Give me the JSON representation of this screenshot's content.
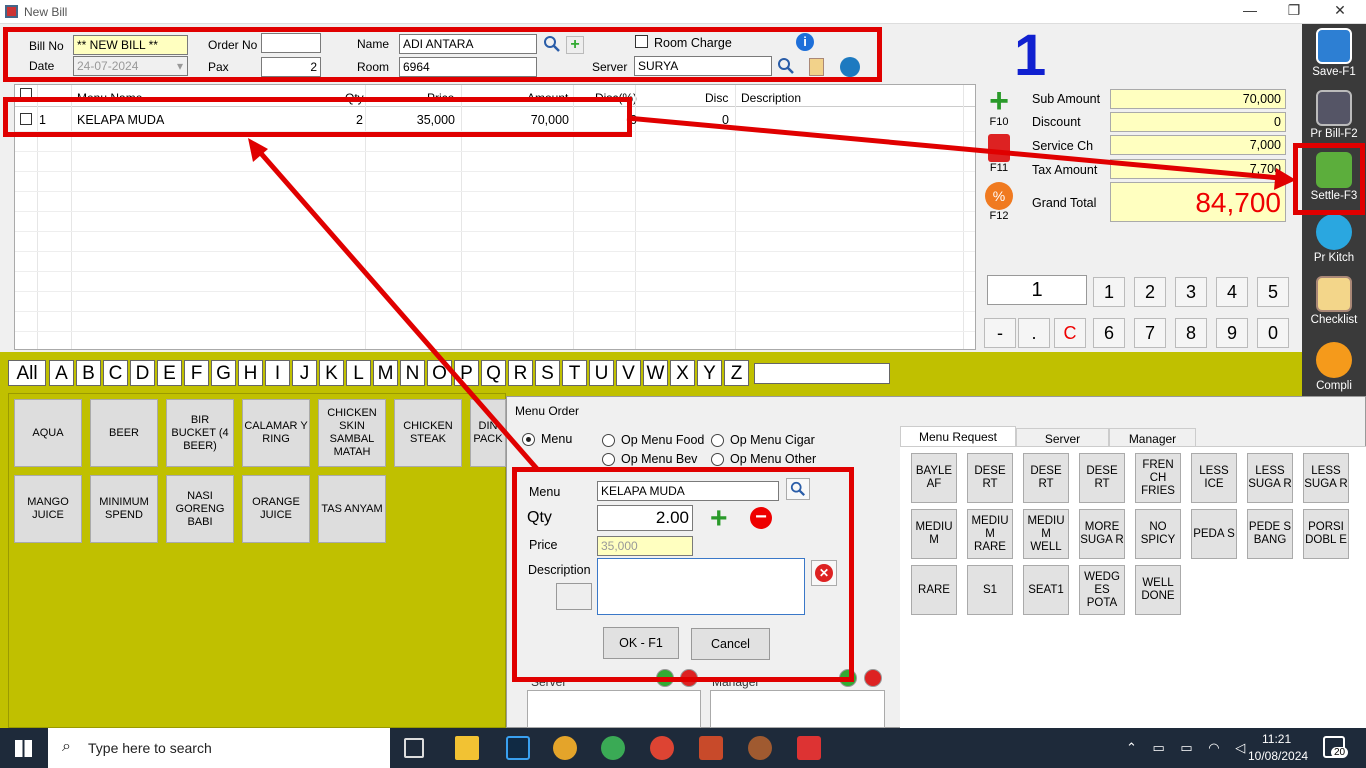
{
  "window": {
    "title": "New Bill",
    "min": "—",
    "max": "❐",
    "close": "✕"
  },
  "header": {
    "bill_no_label": "Bill No",
    "bill_no": "** NEW BILL **",
    "date_label": "Date",
    "date": "24-07-2024",
    "order_no_label": "Order No",
    "order_no": "",
    "pax_label": "Pax",
    "pax": "2",
    "name_label": "Name",
    "name": "ADI ANTARA",
    "room_label": "Room",
    "room": "6964",
    "room_charge_label": "Room Charge",
    "server_label": "Server",
    "server": "SURYA"
  },
  "table_number": "1",
  "grid": {
    "columns": [
      "Menu Name",
      "Qty",
      "Price",
      "Amount",
      "Disc(%)",
      "Disc",
      "Description"
    ],
    "rows": [
      {
        "no": "1",
        "name": "KELAPA MUDA",
        "qty": "2",
        "price": "35,000",
        "amount": "70,000",
        "disc_pct": "0",
        "disc": "0",
        "desc": ""
      }
    ]
  },
  "side_buttons": {
    "add": "F10",
    "delete": "F11",
    "discount": "F12"
  },
  "totals": {
    "sub_amount_label": "Sub Amount",
    "sub_amount": "70,000",
    "discount_label": "Discount",
    "discount": "0",
    "service_label": "Service Ch",
    "service": "7,000",
    "tax_label": "Tax Amount",
    "tax": "7,700",
    "grand_label": "Grand Total",
    "grand": "84,700"
  },
  "keypad": {
    "display": "1",
    "row1": [
      "1",
      "2",
      "3",
      "4",
      "5"
    ],
    "row2": [
      "6",
      "7",
      "8",
      "9",
      "0"
    ],
    "minus": "-",
    "dot": ".",
    "clear": "C"
  },
  "right_bar": [
    "Save-F1",
    "Pr Bill-F2",
    "Settle-F3",
    "Pr Kitch",
    "Checklist",
    "Compli"
  ],
  "letters": [
    "All",
    "A",
    "B",
    "C",
    "D",
    "E",
    "F",
    "G",
    "H",
    "I",
    "J",
    "K",
    "L",
    "M",
    "N",
    "O",
    "P",
    "Q",
    "R",
    "S",
    "T",
    "U",
    "V",
    "W",
    "X",
    "Y",
    "Z"
  ],
  "menu_items": [
    "AQUA",
    "BEER",
    "BIR BUCKET (4 BEER)",
    "CALAMAR Y RING",
    "CHICKEN SKIN SAMBAL MATAH",
    "CHICKEN STEAK",
    "DIN PACK",
    "MANGO JUICE",
    "MINIMUM SPEND",
    "NASI GORENG BABI",
    "ORANGE JUICE",
    "TAS ANYAM"
  ],
  "dialog": {
    "title": "Menu Order",
    "radios": [
      "Menu",
      "Op Menu Food",
      "Op Menu Cigar",
      "Op Menu Bev",
      "Op Menu Other"
    ],
    "menu_label": "Menu",
    "menu_value": "KELAPA MUDA",
    "qty_label": "Qty",
    "qty_value": "2.00",
    "price_label": "Price",
    "price_value": "35,000",
    "desc_label": "Description",
    "ok": "OK - F1",
    "cancel": "Cancel",
    "server_label": "Server",
    "manager_label": "Manager",
    "tabs": [
      "Menu Request",
      "Server",
      "Manager"
    ],
    "requests": [
      "BAYLE AF",
      "DESE RT",
      "DESE RT",
      "DESE RT",
      "FREN CH FRIES",
      "LESS ICE",
      "LESS SUGA R",
      "LESS SUGA R",
      "MEDIU M",
      "MEDIU M RARE",
      "MEDIU M WELL",
      "MORE SUGA R",
      "NO SPICY",
      "PEDA S",
      "PEDE S BANG",
      "PORSI DOBL E",
      "RARE",
      "S1",
      "SEAT1",
      "WEDG ES POTA",
      "WELL DONE"
    ]
  },
  "taskbar": {
    "search": "Type here to search",
    "time": "11:21",
    "date": "10/08/2024",
    "notif": "20"
  }
}
